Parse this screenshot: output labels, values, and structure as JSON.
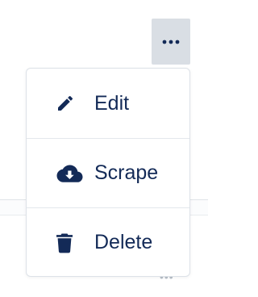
{
  "menu": {
    "items": [
      {
        "label": "Edit",
        "icon": "pencil-icon"
      },
      {
        "label": "Scrape",
        "icon": "cloud-download-icon"
      },
      {
        "label": "Delete",
        "icon": "trash-icon"
      }
    ]
  },
  "more_button": {
    "icon": "ellipsis-icon"
  },
  "background": {
    "row_more_icon": "ellipsis-icon"
  },
  "colors": {
    "text": "#132a57",
    "more_button_bg": "#d9dee4",
    "border": "#dde2e8"
  }
}
